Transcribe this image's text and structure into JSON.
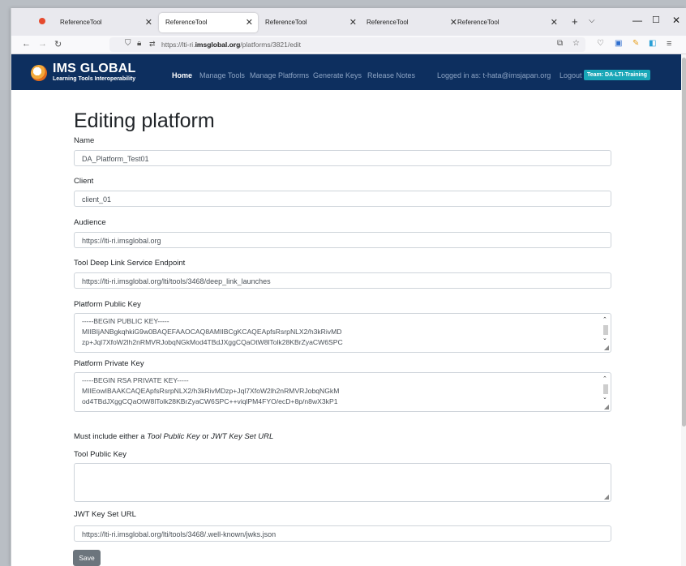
{
  "browser": {
    "tabs": [
      {
        "title": "ReferenceTool",
        "active": false
      },
      {
        "title": "ReferenceTool",
        "active": true
      },
      {
        "title": "ReferenceTool",
        "active": false
      },
      {
        "title": "ReferenceTool",
        "active": false
      },
      {
        "title": "ReferenceTool",
        "active": false
      }
    ],
    "url_prefix": "https://lti-ri.",
    "url_domain": "imsglobal.org",
    "url_path": "/platforms/3821/edit"
  },
  "header": {
    "logo_title": "IMS GLOBAL",
    "logo_subtitle": "Learning Tools Interoperability",
    "nav": [
      "Home",
      "Manage Tools",
      "Manage Platforms",
      "Generate Keys",
      "Release Notes"
    ],
    "logged_in": "Logged in as: t-hata@imsjapan.org",
    "logout": "Logout",
    "team_badge": "Team: DA-LTI-Training"
  },
  "form": {
    "title": "Editing platform",
    "name_label": "Name",
    "name_value": "DA_Platform_Test01",
    "client_label": "Client",
    "client_value": "client_01",
    "audience_label": "Audience",
    "audience_value": "https://lti-ri.imsglobal.org",
    "deeplink_label": "Tool Deep Link Service Endpoint",
    "deeplink_value": "https://lti-ri.imsglobal.org/lti/tools/3468/deep_link_launches",
    "public_key_label": "Platform Public Key",
    "public_key_lines": [
      "-----BEGIN PUBLIC KEY-----",
      "MIIBIjANBgkqhkiG9w0BAQEFAAOCAQ8AMIIBCgKCAQEApfsRsrpNLX2/h3kRivMD",
      "zp+Jql7XfoW2lh2nRMVRJobqNGkMod4TBdJXggCQaOtW8lTolk28KBrZyaCW6SPC"
    ],
    "private_key_label": "Platform Private Key",
    "private_key_lines": [
      "-----BEGIN RSA PRIVATE KEY-----",
      "MIIEowIBAAKCAQEApfsRsrpNLX2/h3kRivMDzp+Jql7XfoW2lh2nRMVRJobqNGkM",
      "od4TBdJXggCQaOtW8lTolk28KBrZyaCW6SPC++viqlPM4FYO/ecD+8p/n8wX3kP1"
    ],
    "must_include_prefix": "Must include either a ",
    "must_include_opt1": "Tool Public Key",
    "must_include_or": " or ",
    "must_include_opt2": "JWT Key Set URL",
    "tool_public_key_label": "Tool Public Key",
    "tool_public_key_value": "",
    "jwks_label": "JWT Key Set URL",
    "jwks_value": "https://lti-ri.imsglobal.org/lti/tools/3468/.well-known/jwks.json",
    "save_label": "Save"
  }
}
